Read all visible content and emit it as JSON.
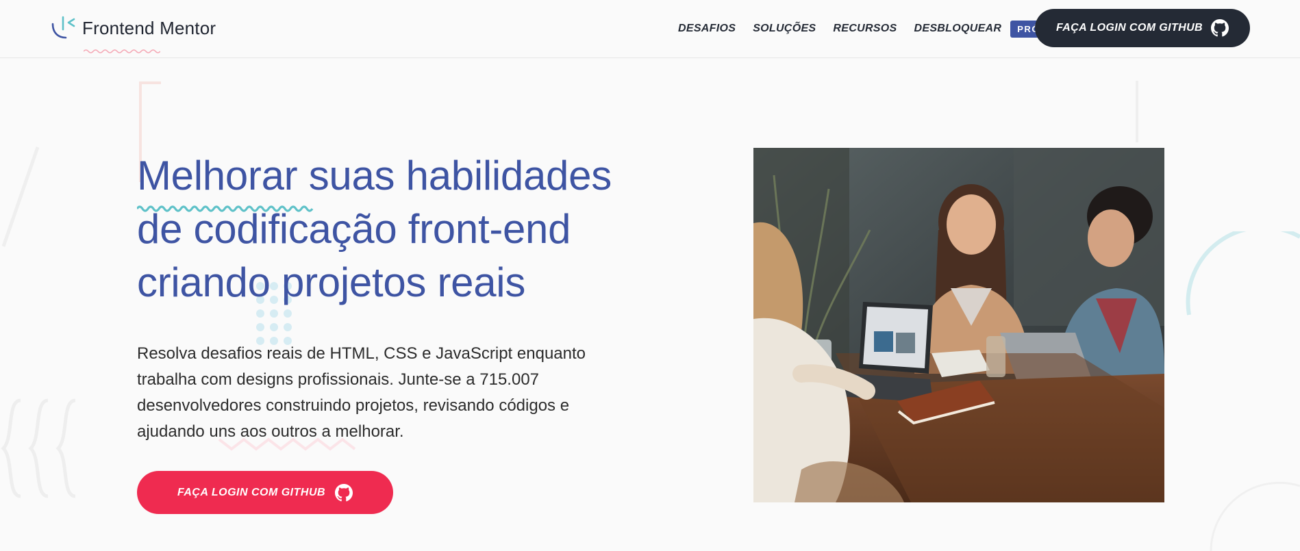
{
  "brand": {
    "name": "Frontend Mentor"
  },
  "nav": {
    "items": [
      "DESAFIOS",
      "SOLUÇÕES",
      "RECURSOS",
      "DESBLOQUEAR"
    ],
    "pro_badge": "PRÓ",
    "login_label": "FAÇA LOGIN COM GITHUB"
  },
  "hero": {
    "title_lines": [
      "Melhorar suas habilidades",
      "de codificação front-end",
      "criando projetos reais"
    ],
    "description": "Resolva desafios reais de HTML, CSS e JavaScript enquanto trabalha com designs profissionais. Junte-se a 715.007 desenvolvedores construindo projetos, revisando códigos e ajudando uns aos outros a melhorar.",
    "cta_label": "FAÇA LOGIN COM GITHUB"
  },
  "icons": {
    "logo": "frontend-mentor-logo-icon",
    "github": "github-icon"
  },
  "colors": {
    "primary": "#3e54a3",
    "accent": "#ef2b50",
    "dark": "#242a35",
    "teal": "#5ec1c8",
    "background": "#fafafa"
  }
}
